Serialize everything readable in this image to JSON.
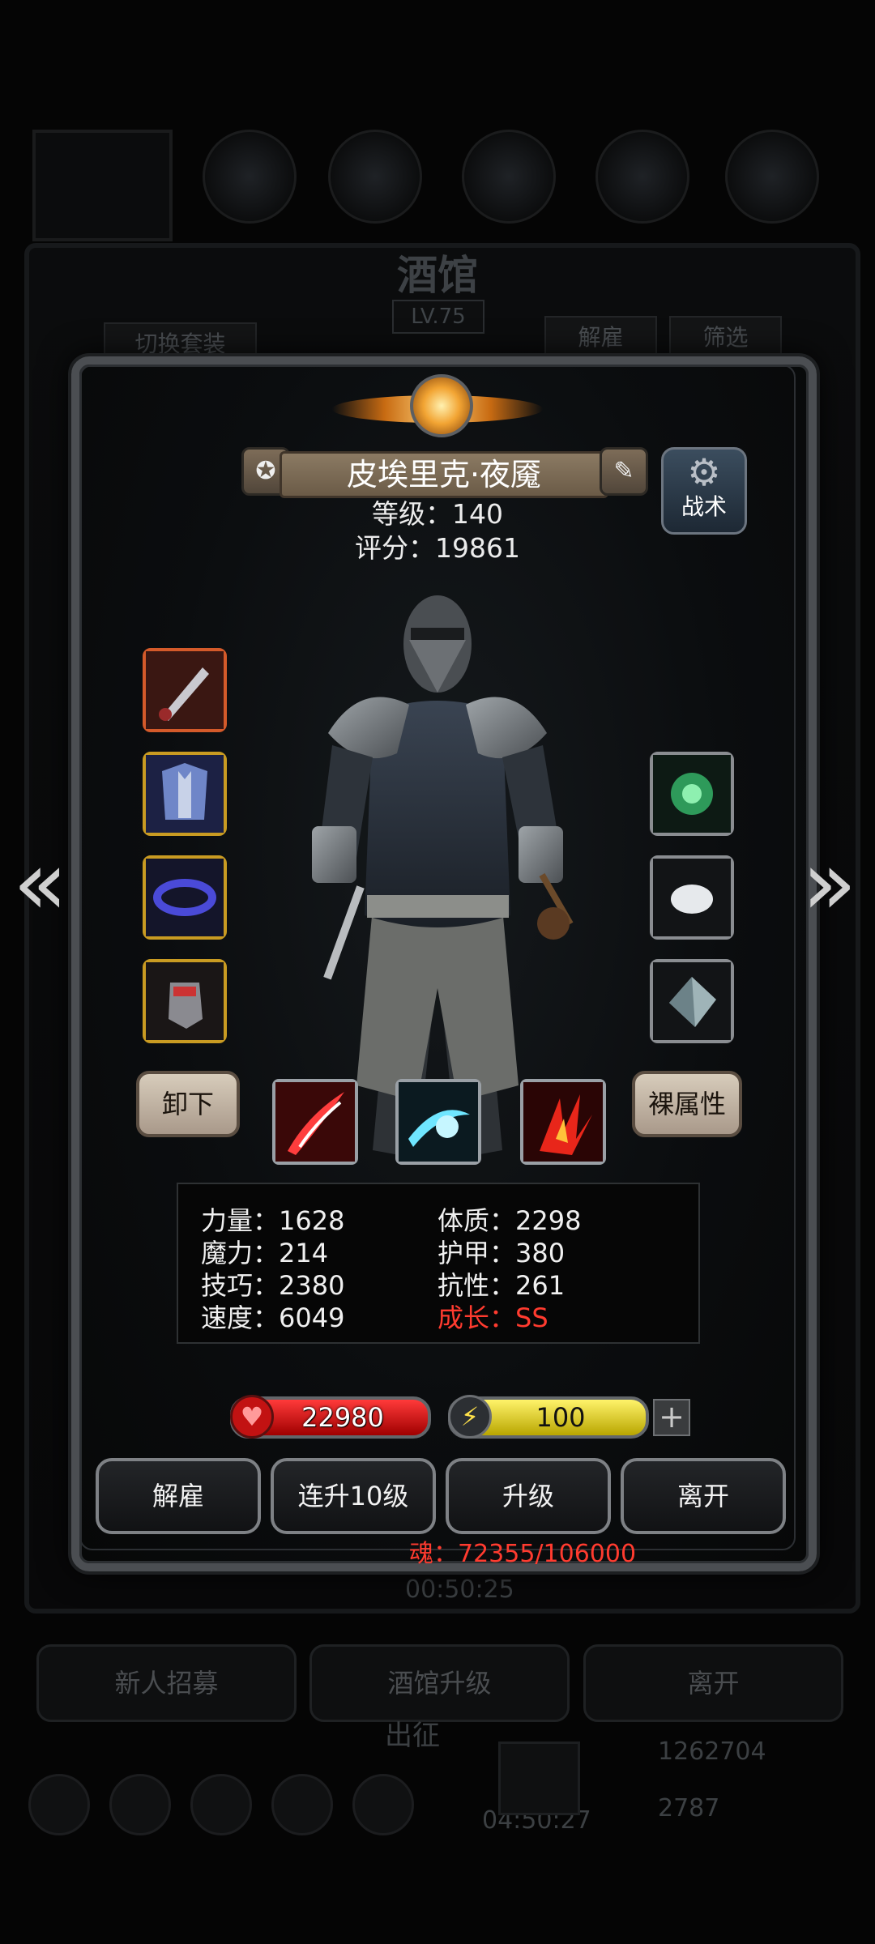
{
  "background": {
    "title": "酒馆",
    "level": "LV.75",
    "switch_outfit": "切换套装",
    "dismiss": "解雇",
    "filter": "筛选",
    "timer": "00:50:25",
    "recruit": "新人招募",
    "upgrade_tavern": "酒馆升级",
    "leave": "离开",
    "expedition": "出征",
    "gold": "1262704",
    "gems": "2787",
    "bottom_timer": "04:50:27"
  },
  "hero": {
    "name": "皮埃里克·夜魇",
    "level_text": "等级：140",
    "score_text": "评分：19861",
    "tactics_label": "战术"
  },
  "equipment": {
    "left": [
      "dagger",
      "armor",
      "belt",
      "gauntlet"
    ],
    "right": [
      "green-gem",
      "white-stone",
      "crystal"
    ]
  },
  "actions": {
    "unequip": "卸下",
    "base_attr": "裸属性"
  },
  "skills": [
    "red-slash",
    "cyan-slash",
    "fire-claw"
  ],
  "attributes": {
    "strength": "力量：1628",
    "constitution": "体质：2298",
    "magic": "魔力：214",
    "armor": "护甲：380",
    "skill": "技巧：2380",
    "resistance": "抗性：261",
    "speed": "速度：6049",
    "growth": "成长：SS"
  },
  "bars": {
    "hp": "22980",
    "energy": "100"
  },
  "buttons": {
    "dismiss": "解雇",
    "level10": "连升10级",
    "upgrade": "升级",
    "leave": "离开"
  },
  "soul": "魂：72355/106000",
  "colors": {
    "growth": "#ff3b2f",
    "hp": "#d01010",
    "energy": "#e6d31c",
    "gold_border": "#c99b22"
  }
}
